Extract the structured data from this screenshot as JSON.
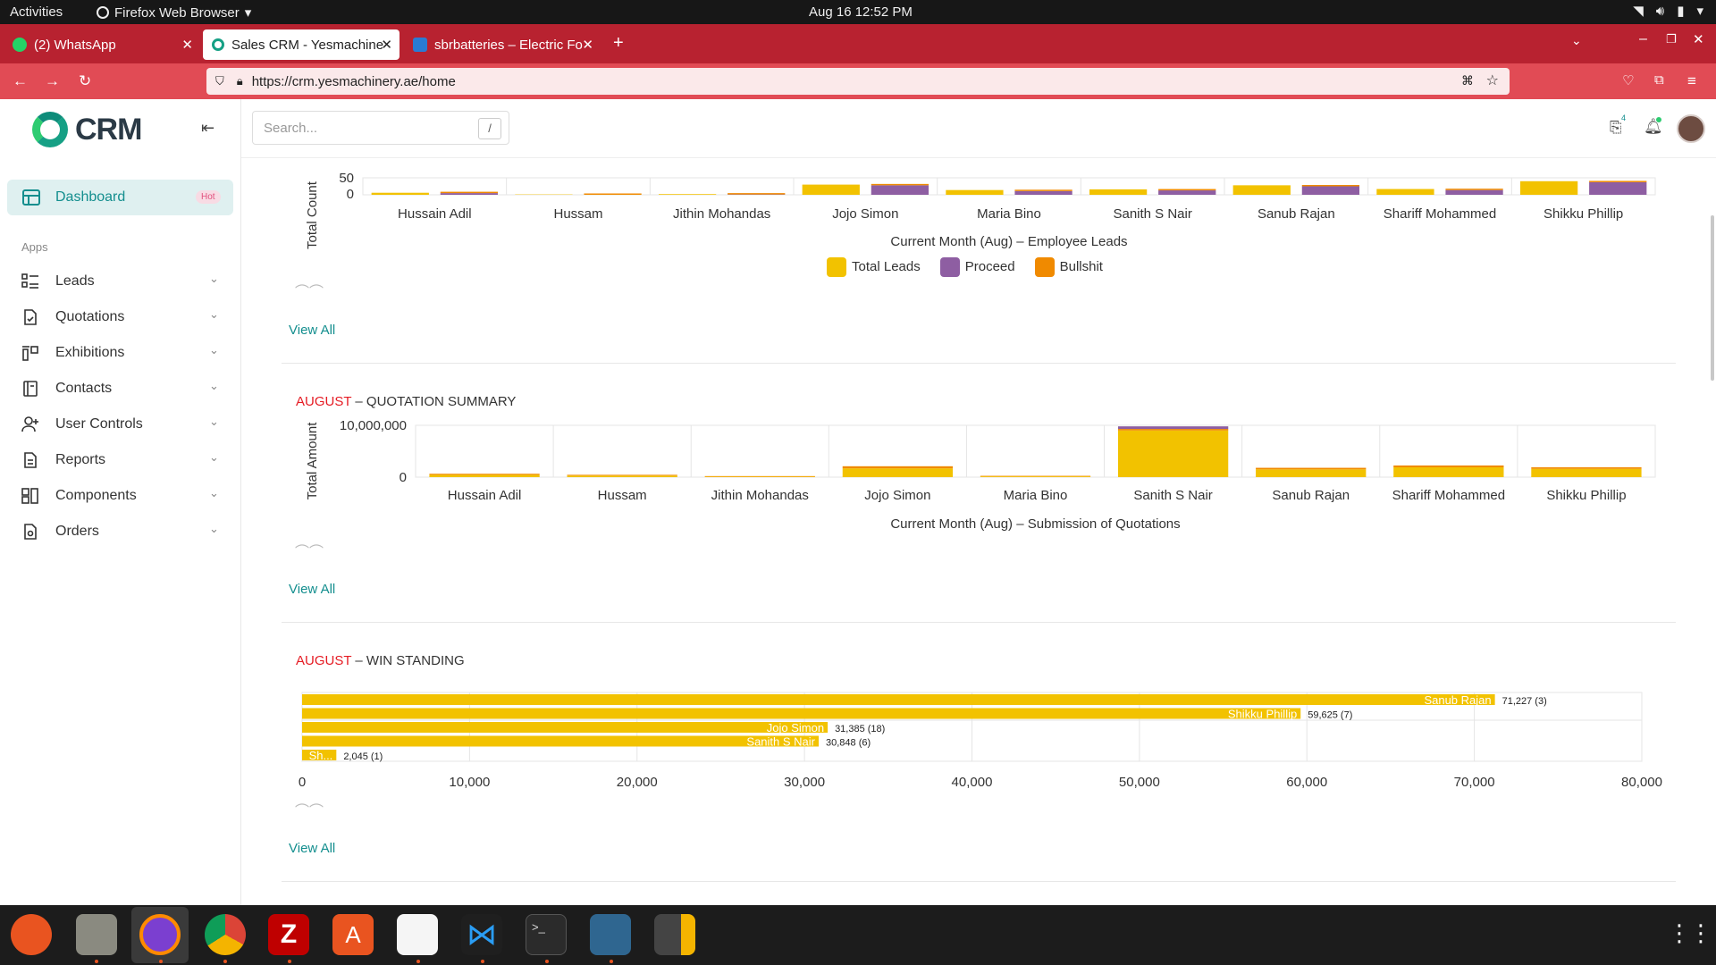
{
  "topbar": {
    "activities": "Activities",
    "app_name": "Firefox Web Browser",
    "clock": "Aug 16  12:52 PM"
  },
  "browser": {
    "tabs": [
      {
        "title": "(2) WhatsApp",
        "icon": "whatsapp-icon",
        "active": false
      },
      {
        "title": "Sales CRM - Yesmachiner",
        "icon": "crm-icon",
        "active": true
      },
      {
        "title": "sbrbatteries – Electric Fo",
        "icon": "batteries-icon",
        "active": false
      }
    ],
    "url": "https://crm.yesmachinery.ae/home"
  },
  "sidebar": {
    "logo_text": "CRM",
    "dashboard_label": "Dashboard",
    "dashboard_badge": "Hot",
    "apps_heading": "Apps",
    "items": [
      {
        "label": "Leads",
        "icon": "list-icon"
      },
      {
        "label": "Quotations",
        "icon": "document-check-icon"
      },
      {
        "label": "Exhibitions",
        "icon": "exhibition-icon"
      },
      {
        "label": "Contacts",
        "icon": "contacts-book-icon"
      },
      {
        "label": "User Controls",
        "icon": "user-plus-icon"
      },
      {
        "label": "Reports",
        "icon": "report-icon"
      },
      {
        "label": "Components",
        "icon": "components-icon"
      },
      {
        "label": "Orders",
        "icon": "orders-icon"
      }
    ]
  },
  "header": {
    "search_placeholder": "Search...",
    "search_shortcut": "/",
    "inbox_count": "4"
  },
  "sections": {
    "leads": {
      "view_all": "View All"
    },
    "quotation": {
      "month": "AUGUST",
      "title": " – QUOTATION SUMMARY",
      "view_all": "View All"
    },
    "win": {
      "month": "AUGUST",
      "title": " – WIN STANDING",
      "view_all": "View All"
    }
  },
  "colors": {
    "total_leads": "#f2c200",
    "proceed": "#8e5ea2",
    "bullshit": "#f08a00",
    "accent": "#138e8e",
    "month_red": "#e51b23"
  },
  "chart_data": [
    {
      "type": "bar",
      "title": "",
      "xlabel": "Current Month (Aug) – Employee Leads",
      "ylabel": "Total Count",
      "yticks": [
        "50",
        "0"
      ],
      "ylim": [
        0,
        50
      ],
      "categories": [
        "Hussain Adil",
        "Hussam",
        "Jithin Mohandas",
        "Jojo Simon",
        "Maria Bino",
        "Sanith S Nair",
        "Sanub Rajan",
        "Shariff Mohammed",
        "Shikku Phillip"
      ],
      "series": [
        {
          "name": "Total Leads",
          "values": [
            6,
            1,
            2,
            30,
            14,
            16,
            28,
            17,
            40
          ]
        },
        {
          "name": "Proceed",
          "values": [
            5,
            0,
            1,
            28,
            11,
            13,
            25,
            14,
            37
          ]
        },
        {
          "name": "Bullshit",
          "values": [
            1,
            1,
            1,
            1,
            1,
            1,
            1,
            1,
            1
          ]
        }
      ],
      "legend": "bottom"
    },
    {
      "type": "bar",
      "stacked": true,
      "title": "",
      "xlabel": "Current Month (Aug) – Submission of Quotations",
      "ylabel": "Total Amount",
      "yticks": [
        "10,000,000",
        "0"
      ],
      "ylim": [
        0,
        10000000
      ],
      "categories": [
        "Hussain Adil",
        "Hussam",
        "Jithin Mohandas",
        "Jojo Simon",
        "Maria Bino",
        "Sanith S Nair",
        "Sanub Rajan",
        "Shariff Mohammed",
        "Shikku Phillip"
      ],
      "series": [
        {
          "name": "Yellow",
          "values": [
            450000,
            300000,
            100000,
            1700000,
            150000,
            9000000,
            1500000,
            1900000,
            1600000
          ]
        },
        {
          "name": "Orange",
          "values": [
            200000,
            150000,
            100000,
            400000,
            100000,
            300000,
            300000,
            350000,
            300000
          ]
        },
        {
          "name": "Purple",
          "values": [
            0,
            0,
            0,
            0,
            0,
            500000,
            0,
            0,
            0
          ]
        }
      ]
    },
    {
      "type": "bar",
      "orientation": "horizontal",
      "title": "",
      "xlim": [
        0,
        80000
      ],
      "xticks": [
        "0",
        "10,000",
        "20,000",
        "30,000",
        "40,000",
        "50,000",
        "60,000",
        "70,000",
        "80,000"
      ],
      "bars": [
        {
          "name": "Sanub Rajan",
          "value": 71227,
          "label": "71,227 (3)"
        },
        {
          "name": "Shikku Phillip",
          "value": 59625,
          "label": "59,625 (7)"
        },
        {
          "name": "Jojo Simon",
          "value": 31385,
          "label": "31,385 (18)"
        },
        {
          "name": "Sanith S Nair",
          "value": 30848,
          "label": "30,848 (6)"
        },
        {
          "name": "Sh...",
          "value": 2045,
          "label": "2,045 (1)"
        }
      ]
    }
  ],
  "legend1": [
    {
      "name": "Total Leads",
      "color": "#f2c200"
    },
    {
      "name": "Proceed",
      "color": "#8e5ea2"
    },
    {
      "name": "Bullshit",
      "color": "#f08a00"
    }
  ]
}
